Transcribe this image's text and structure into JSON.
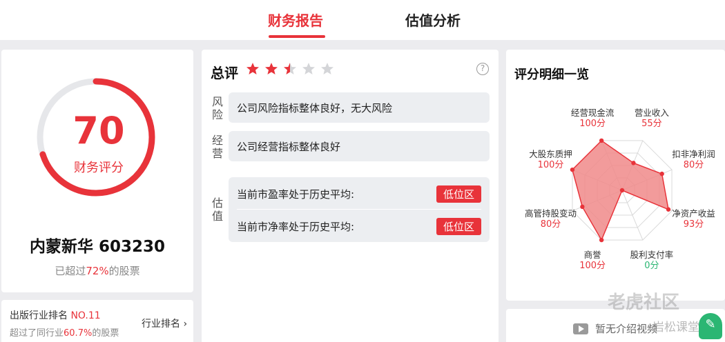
{
  "tabs": [
    {
      "label": "财务报告",
      "active": true
    },
    {
      "label": "估值分析",
      "active": false
    }
  ],
  "score_card": {
    "score": "70",
    "score_fraction": 0.7,
    "score_label": "财务评分",
    "company": "内蒙新华 603230",
    "beat_prefix": "已超过",
    "beat_percent": "72%",
    "beat_suffix": "的股票"
  },
  "rank_card": {
    "rank_prefix": "出版行业排名 ",
    "rank_value": "NO.11",
    "beat_prefix": "超过了同行业",
    "beat_percent": "60.7%",
    "beat_suffix": "的股票",
    "link_label": "行业排名"
  },
  "summary": {
    "title": "总评",
    "rating": 2.5,
    "rating_max": 5,
    "help_icon": "?",
    "categories": [
      {
        "label_1": "风",
        "label_2": "险",
        "text": "公司风险指标整体良好，无大风险"
      },
      {
        "label_1": "经",
        "label_2": "营",
        "text": "公司经营指标整体良好"
      }
    ],
    "valuation": {
      "label_1": "估",
      "label_2": "值",
      "rows": [
        {
          "text": "当前市盈率处于历史平均:",
          "badge": "低位区"
        },
        {
          "text": "当前市净率处于历史平均:",
          "badge": "低位区"
        }
      ]
    }
  },
  "details": {
    "title": "评分明细一览",
    "radar": [
      {
        "name": "营业收入",
        "value": 55,
        "value_label": "55分"
      },
      {
        "name": "扣非净利润",
        "value": 80,
        "value_label": "80分"
      },
      {
        "name": "净资产收益",
        "value": 93,
        "value_label": "93分"
      },
      {
        "name": "股利支付率",
        "value": 0,
        "value_label": "0分"
      },
      {
        "name": "商誉",
        "value": 100,
        "value_label": "100分"
      },
      {
        "name": "高管持股变动",
        "value": 80,
        "value_label": "80分"
      },
      {
        "name": "大股东质押",
        "value": 100,
        "value_label": "100分"
      },
      {
        "name": "经营现金流",
        "value": 100,
        "value_label": "100分"
      }
    ]
  },
  "intro": {
    "empty_text": "暂无介绍视频"
  },
  "watermark": {
    "main": "老虎社区",
    "sub": "岩松课堂"
  },
  "colors": {
    "accent": "#e8333a",
    "green": "#2bb673",
    "radar_fill": "#f08a8a"
  }
}
